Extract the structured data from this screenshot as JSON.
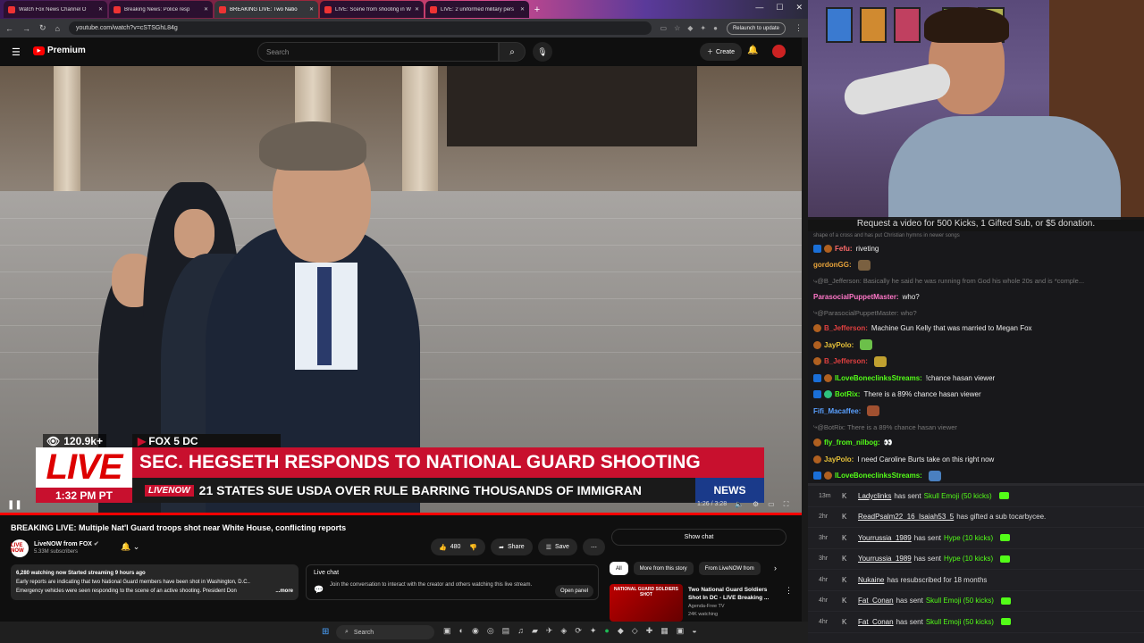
{
  "browser": {
    "tabs": [
      {
        "title": "Watch Fox News Channel O",
        "active": false
      },
      {
        "title": "Breaking News: Police resp",
        "active": false
      },
      {
        "title": "BREAKING LIVE: Two Natio",
        "active": true
      },
      {
        "title": "LIVE: Scene from shooting in W",
        "active": false
      },
      {
        "title": "LIVE: 2 uniformed military pers",
        "active": false
      }
    ],
    "new_tab": "+",
    "url": "youtube.com/watch?v=cSTSGhL84g",
    "relaunch": "Relaunch to update"
  },
  "youtube": {
    "logo_text": "Premium",
    "search_placeholder": "Search",
    "create_label": "Create"
  },
  "video": {
    "viewers": "120.9k+",
    "station": "FOX 5 DC",
    "live_badge": "LIVE",
    "time": "1:32 PM PT",
    "headline": "SEC. HEGSETH RESPONDS TO NATIONAL GUARD SHOOTING",
    "ticker_logo": "LIVENOW",
    "ticker": "21 STATES SUE USDA OVER RULE BARRING THOUSANDS OF IMMIGRAN",
    "news_box": "NEWS",
    "elapsed": "1:26 / 3:28",
    "progress": 1.0
  },
  "info": {
    "title": "BREAKING LIVE: Multiple Nat'l Guard troops shot near White House, conflicting reports",
    "channel": "LiveNOW from FOX",
    "channel_avatar": "LIVE NOW",
    "subscribers": "5.33M subscribers",
    "likes": "480",
    "share": "Share",
    "save": "Save",
    "desc_meta": "6,280 watching now  Started streaming 9 hours ago",
    "desc_text": "Early reports are indicating that two National Guard members have been shot in Washington, D.C.. Emergency vehicles were seen responding to the scene of an active shooting. President Don",
    "desc_more": "...more",
    "live_chat_label": "Live chat",
    "live_chat_text": "Join the conversation to interact with the creator and others watching this live stream.",
    "open_panel": "Open panel",
    "show_chat": "Show chat",
    "chips": [
      "All",
      "More from this story",
      "From LiveNOW from"
    ],
    "related": {
      "thumb_text": "NATIONAL GUARD SOLDIERS SHOT",
      "title": "Two National Guard Soldiers Shot In DC - LIVE Breaking ...",
      "channel": "Agenda-Free TV",
      "watching": "24K watching"
    }
  },
  "taskbar": {
    "search": "Search"
  },
  "stream": {
    "banner": "Request a video for 500 Kicks, 1 Gifted Sub, or $5 donation.",
    "overflow_line": "shape of a cross and has put Christian hymns in newer songs",
    "chat": [
      {
        "user": "Fefu:",
        "text": "riveting",
        "color": "#ff6b6b",
        "badges": [
          "x",
          "o"
        ],
        "emote": "",
        "dim": false
      },
      {
        "user": "gordonGG:",
        "text": "",
        "color": "#e8a33a",
        "badges": [],
        "emote": "#7a6040",
        "dim": false
      },
      {
        "user": "",
        "text": "@B_Jefferson: Basically he said he was running from God his whole 20s and is *comple...",
        "color": "#777",
        "badges": [],
        "emote": "",
        "dim": true
      },
      {
        "user": "ParasocialPuppetMaster:",
        "text": "who?",
        "color": "#ff77c8",
        "badges": [],
        "emote": "",
        "dim": false
      },
      {
        "user": "",
        "text": "@ParasocialPuppetMaster: who?",
        "color": "#777",
        "badges": [],
        "emote": "",
        "dim": true
      },
      {
        "user": "B_Jefferson:",
        "text": "Machine Gun Kelly that was married to Megan Fox",
        "color": "#e04040",
        "badges": [
          "o"
        ],
        "emote": "",
        "dim": false
      },
      {
        "user": "JayPolo:",
        "text": "",
        "color": "#e8c33a",
        "badges": [
          "o"
        ],
        "emote": "#6cc04a",
        "dim": false
      },
      {
        "user": "B_Jefferson:",
        "text": "",
        "color": "#e04040",
        "badges": [
          "o"
        ],
        "emote": "#c0a030",
        "dim": false
      },
      {
        "user": "ILoveBoneclinksStreams:",
        "text": "!chance hasan viewer",
        "color": "#53fc18",
        "badges": [
          "x",
          "o"
        ],
        "emote": "",
        "dim": false
      },
      {
        "user": "BotRix:",
        "text": "There is a 89% chance hasan viewer",
        "color": "#53fc18",
        "badges": [
          "x",
          "g"
        ],
        "emote": "",
        "dim": false
      },
      {
        "user": "Fifi_Macaffee:",
        "text": "",
        "color": "#5aa0ff",
        "badges": [],
        "emote": "#a05030",
        "dim": false
      },
      {
        "user": "",
        "text": "@BotRix: There is a 89% chance hasan viewer",
        "color": "#777",
        "badges": [],
        "emote": "",
        "dim": true
      },
      {
        "user": "fly_from_nilbog:",
        "text": "👀",
        "color": "#53fc18",
        "badges": [
          "o"
        ],
        "emote": "",
        "dim": false
      },
      {
        "user": "JayPolo:",
        "text": "I need Caroline Burts take on this right now",
        "color": "#e8c33a",
        "badges": [
          "o"
        ],
        "emote": "",
        "dim": false
      },
      {
        "user": "ILoveBoneclinksStreams:",
        "text": "",
        "color": "#53fc18",
        "badges": [
          "x",
          "o"
        ],
        "emote": "#4a80c0",
        "dim": false
      }
    ],
    "events": [
      {
        "ago": "13m",
        "user": "Ladyclinks",
        "pre": "has sent",
        "item": "Skull Emoji (50 kicks)",
        "post": "",
        "kick": true
      },
      {
        "ago": "2hr",
        "user": "ReadPsalm22_16_Isaiah53_5",
        "pre": "has gifted a sub to",
        "item": "",
        "post": "carbycee.",
        "kick": false
      },
      {
        "ago": "3hr",
        "user": "Yourrussia_1989",
        "pre": "has sent",
        "item": "Hype (10 kicks)",
        "post": "",
        "kick": true
      },
      {
        "ago": "3hr",
        "user": "Yourrussia_1989",
        "pre": "has sent",
        "item": "Hype (10 kicks)",
        "post": "",
        "kick": true
      },
      {
        "ago": "4hr",
        "user": "Nukaine",
        "pre": "has resubscribed for 18 months",
        "item": "",
        "post": "",
        "kick": false
      },
      {
        "ago": "4hr",
        "user": "Fat_Conan",
        "pre": "has sent",
        "item": "Skull Emoji (50 kicks)",
        "post": "",
        "kick": true
      },
      {
        "ago": "4hr",
        "user": "Fat_Conan",
        "pre": "has sent",
        "item": "Skull Emoji (50 kicks)",
        "post": "",
        "kick": true
      }
    ]
  }
}
